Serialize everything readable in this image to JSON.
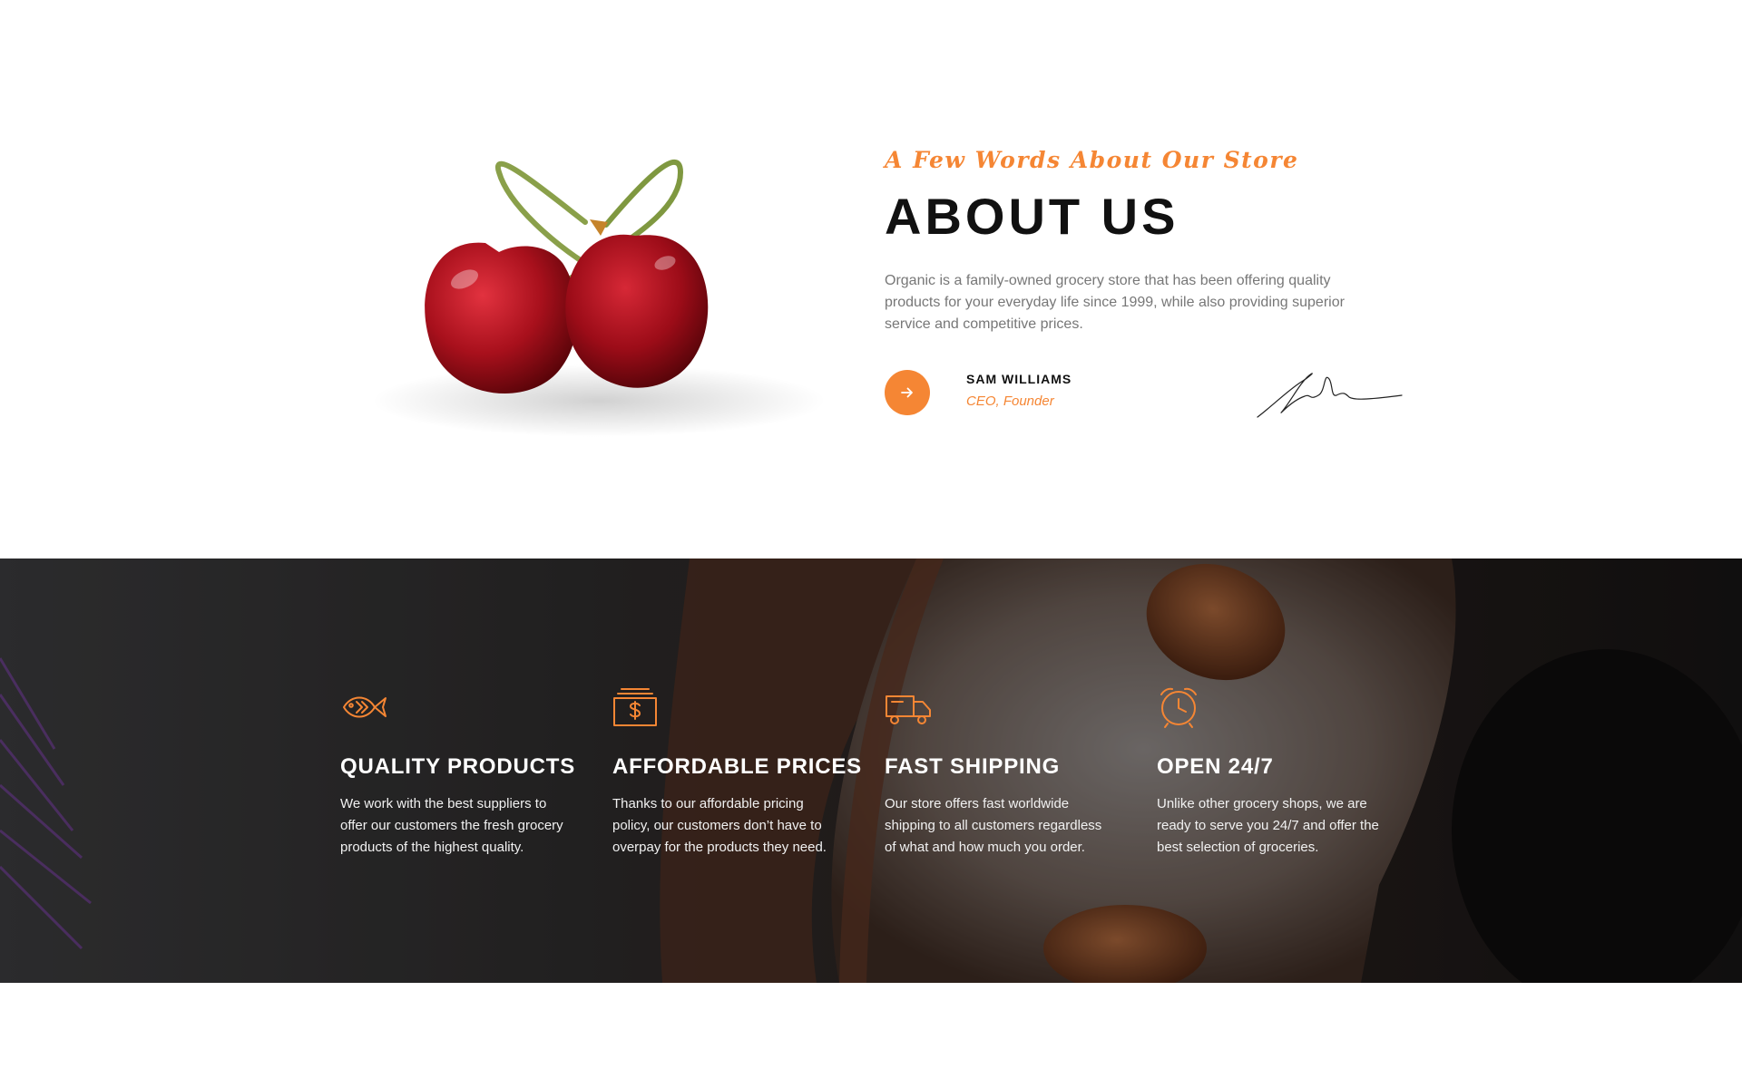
{
  "about": {
    "kicker": "A Few Words About Our Store",
    "title": "ABOUT US",
    "description": "Organic is a family-owned grocery store that has been offering quality products for your everyday life since 1999, while also providing superior service and competitive prices.",
    "author_name": "SAM WILLIAMS",
    "author_role": "CEO, Founder",
    "arrow_icon": "arrow-right-icon",
    "image_icon": "cherries-image"
  },
  "features": [
    {
      "icon": "fish-icon",
      "title": "QUALITY PRODUCTS",
      "text": "We work with the best suppliers to offer our customers the fresh grocery products of the highest quality."
    },
    {
      "icon": "money-icon",
      "title": "AFFORDABLE PRICES",
      "text": "Thanks to our affordable pricing policy, our customers don’t have to overpay for the products they need."
    },
    {
      "icon": "truck-icon",
      "title": "FAST SHIPPING",
      "text": "Our store offers fast worldwide shipping to all customers regardless of what and how much you order."
    },
    {
      "icon": "alarm-clock-icon",
      "title": "OPEN 24/7",
      "text": "Unlike other grocery shops, we are ready to serve you 24/7 and offer the best selection of groceries."
    }
  ],
  "colors": {
    "accent": "#f58634",
    "heading": "#111111",
    "body_text": "#777777",
    "band_text": "#ffffff"
  }
}
